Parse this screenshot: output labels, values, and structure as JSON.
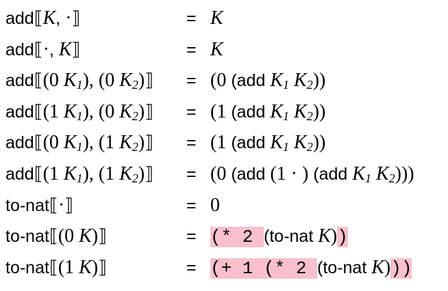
{
  "equations": [
    {
      "lhs": [
        {
          "t": "add",
          "c": "sf"
        },
        {
          "t": "⟦",
          "c": "brk"
        },
        {
          "t": "K",
          "c": "it"
        },
        {
          "t": ", ",
          "c": "sf"
        },
        {
          "t": "·",
          "c": "serif"
        },
        {
          "t": "⟧",
          "c": "brk"
        }
      ],
      "eq": "=",
      "rhs": [
        {
          "t": "K",
          "c": "it"
        }
      ]
    },
    {
      "lhs": [
        {
          "t": "add",
          "c": "sf"
        },
        {
          "t": "⟦",
          "c": "brk"
        },
        {
          "t": "·",
          "c": "serif"
        },
        {
          "t": ", ",
          "c": "sf"
        },
        {
          "t": "K",
          "c": "it"
        },
        {
          "t": "⟧",
          "c": "brk"
        }
      ],
      "eq": "=",
      "rhs": [
        {
          "t": "K",
          "c": "it"
        }
      ]
    },
    {
      "lhs": [
        {
          "t": "add",
          "c": "sf"
        },
        {
          "t": "⟦",
          "c": "brk"
        },
        {
          "t": "(0 ",
          "c": "serif"
        },
        {
          "t": "K",
          "c": "it"
        },
        {
          "t": "1",
          "c": "sub"
        },
        {
          "t": "),",
          "c": "serif"
        },
        {
          "t": " ",
          "c": "sf"
        },
        {
          "t": "(0 ",
          "c": "serif"
        },
        {
          "t": "K",
          "c": "it"
        },
        {
          "t": "2",
          "c": "sub"
        },
        {
          "t": ")",
          "c": "serif"
        },
        {
          "t": "⟧",
          "c": "brk"
        }
      ],
      "eq": "=",
      "rhs": [
        {
          "t": "(0 ",
          "c": "serif"
        },
        {
          "t": "(add ",
          "c": "sf"
        },
        {
          "t": "K",
          "c": "it"
        },
        {
          "t": "1",
          "c": "sub"
        },
        {
          "t": " ",
          "c": "serif"
        },
        {
          "t": "K",
          "c": "it"
        },
        {
          "t": "2",
          "c": "sub"
        },
        {
          "t": "))",
          "c": "serif"
        }
      ]
    },
    {
      "lhs": [
        {
          "t": "add",
          "c": "sf"
        },
        {
          "t": "⟦",
          "c": "brk"
        },
        {
          "t": "(1 ",
          "c": "serif"
        },
        {
          "t": "K",
          "c": "it"
        },
        {
          "t": "1",
          "c": "sub"
        },
        {
          "t": "),",
          "c": "serif"
        },
        {
          "t": " ",
          "c": "sf"
        },
        {
          "t": "(0 ",
          "c": "serif"
        },
        {
          "t": "K",
          "c": "it"
        },
        {
          "t": "2",
          "c": "sub"
        },
        {
          "t": ")",
          "c": "serif"
        },
        {
          "t": "⟧",
          "c": "brk"
        }
      ],
      "eq": "=",
      "rhs": [
        {
          "t": "(1 ",
          "c": "serif"
        },
        {
          "t": "(add ",
          "c": "sf"
        },
        {
          "t": "K",
          "c": "it"
        },
        {
          "t": "1",
          "c": "sub"
        },
        {
          "t": " ",
          "c": "serif"
        },
        {
          "t": "K",
          "c": "it"
        },
        {
          "t": "2",
          "c": "sub"
        },
        {
          "t": "))",
          "c": "serif"
        }
      ]
    },
    {
      "lhs": [
        {
          "t": "add",
          "c": "sf"
        },
        {
          "t": "⟦",
          "c": "brk"
        },
        {
          "t": "(0 ",
          "c": "serif"
        },
        {
          "t": "K",
          "c": "it"
        },
        {
          "t": "1",
          "c": "sub"
        },
        {
          "t": "),",
          "c": "serif"
        },
        {
          "t": " ",
          "c": "sf"
        },
        {
          "t": "(1 ",
          "c": "serif"
        },
        {
          "t": "K",
          "c": "it"
        },
        {
          "t": "2",
          "c": "sub"
        },
        {
          "t": ")",
          "c": "serif"
        },
        {
          "t": "⟧",
          "c": "brk"
        }
      ],
      "eq": "=",
      "rhs": [
        {
          "t": "(1 ",
          "c": "serif"
        },
        {
          "t": "(add ",
          "c": "sf"
        },
        {
          "t": "K",
          "c": "it"
        },
        {
          "t": "1",
          "c": "sub"
        },
        {
          "t": " ",
          "c": "serif"
        },
        {
          "t": "K",
          "c": "it"
        },
        {
          "t": "2",
          "c": "sub"
        },
        {
          "t": "))",
          "c": "serif"
        }
      ]
    },
    {
      "lhs": [
        {
          "t": "add",
          "c": "sf"
        },
        {
          "t": "⟦",
          "c": "brk"
        },
        {
          "t": "(1 ",
          "c": "serif"
        },
        {
          "t": "K",
          "c": "it"
        },
        {
          "t": "1",
          "c": "sub"
        },
        {
          "t": "),",
          "c": "serif"
        },
        {
          "t": " ",
          "c": "sf"
        },
        {
          "t": "(1 ",
          "c": "serif"
        },
        {
          "t": "K",
          "c": "it"
        },
        {
          "t": "2",
          "c": "sub"
        },
        {
          "t": ")",
          "c": "serif"
        },
        {
          "t": "⟧",
          "c": "brk"
        }
      ],
      "eq": "=",
      "rhs": [
        {
          "t": "(0 ",
          "c": "serif"
        },
        {
          "t": "(add ",
          "c": "sf"
        },
        {
          "t": "(1 · ) ",
          "c": "serif"
        },
        {
          "t": "(add ",
          "c": "sf"
        },
        {
          "t": "K",
          "c": "it"
        },
        {
          "t": "1",
          "c": "sub"
        },
        {
          "t": " ",
          "c": "serif"
        },
        {
          "t": "K",
          "c": "it"
        },
        {
          "t": "2",
          "c": "sub"
        },
        {
          "t": ")))",
          "c": "serif"
        }
      ]
    },
    {
      "lhs": [
        {
          "t": "to-nat",
          "c": "sf"
        },
        {
          "t": "⟦",
          "c": "brk"
        },
        {
          "t": "·",
          "c": "serif"
        },
        {
          "t": "⟧",
          "c": "brk"
        }
      ],
      "eq": "=",
      "rhs": [
        {
          "t": "0",
          "c": "serif"
        }
      ]
    },
    {
      "lhs": [
        {
          "t": "to-nat",
          "c": "sf"
        },
        {
          "t": "⟦",
          "c": "brk"
        },
        {
          "t": "(0 ",
          "c": "serif"
        },
        {
          "t": "K",
          "c": "it"
        },
        {
          "t": ")",
          "c": "serif"
        },
        {
          "t": "⟧",
          "c": "brk"
        }
      ],
      "eq": "=",
      "rhs": [
        {
          "t": "(* 2 ",
          "c": "mono hl"
        },
        {
          "t": " (to-nat ",
          "c": "sf"
        },
        {
          "t": "K",
          "c": "it"
        },
        {
          "t": ")",
          "c": "serif"
        },
        {
          "t": ")",
          "c": "mono hl"
        }
      ]
    },
    {
      "lhs": [
        {
          "t": "to-nat",
          "c": "sf"
        },
        {
          "t": "⟦",
          "c": "brk"
        },
        {
          "t": "(1 ",
          "c": "serif"
        },
        {
          "t": "K",
          "c": "it"
        },
        {
          "t": ")",
          "c": "serif"
        },
        {
          "t": "⟧",
          "c": "brk"
        }
      ],
      "eq": "=",
      "rhs": [
        {
          "t": "(+ 1 (* 2 ",
          "c": "mono hl"
        },
        {
          "t": " (to-nat ",
          "c": "sf"
        },
        {
          "t": "K",
          "c": "it"
        },
        {
          "t": ")",
          "c": "serif"
        },
        {
          "t": "))",
          "c": "mono hl"
        }
      ]
    }
  ]
}
